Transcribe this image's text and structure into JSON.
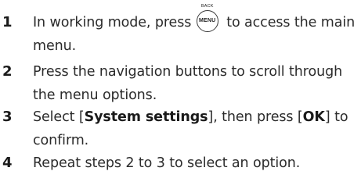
{
  "steps": [
    {
      "number": "1",
      "before": "In working mode, press ",
      "button_top": "BACK",
      "button_label": "MENU",
      "after": " to access the main menu."
    },
    {
      "number": "2",
      "text": "Press the navigation buttons to scroll through the menu options."
    },
    {
      "number": "3",
      "select_word": "Select [",
      "system_settings": "System settings",
      "then_press": "], then press [",
      "ok": "OK",
      "confirm": "] to confirm."
    },
    {
      "number": "4",
      "text": "Repeat steps 2 to 3 to select an option."
    }
  ]
}
